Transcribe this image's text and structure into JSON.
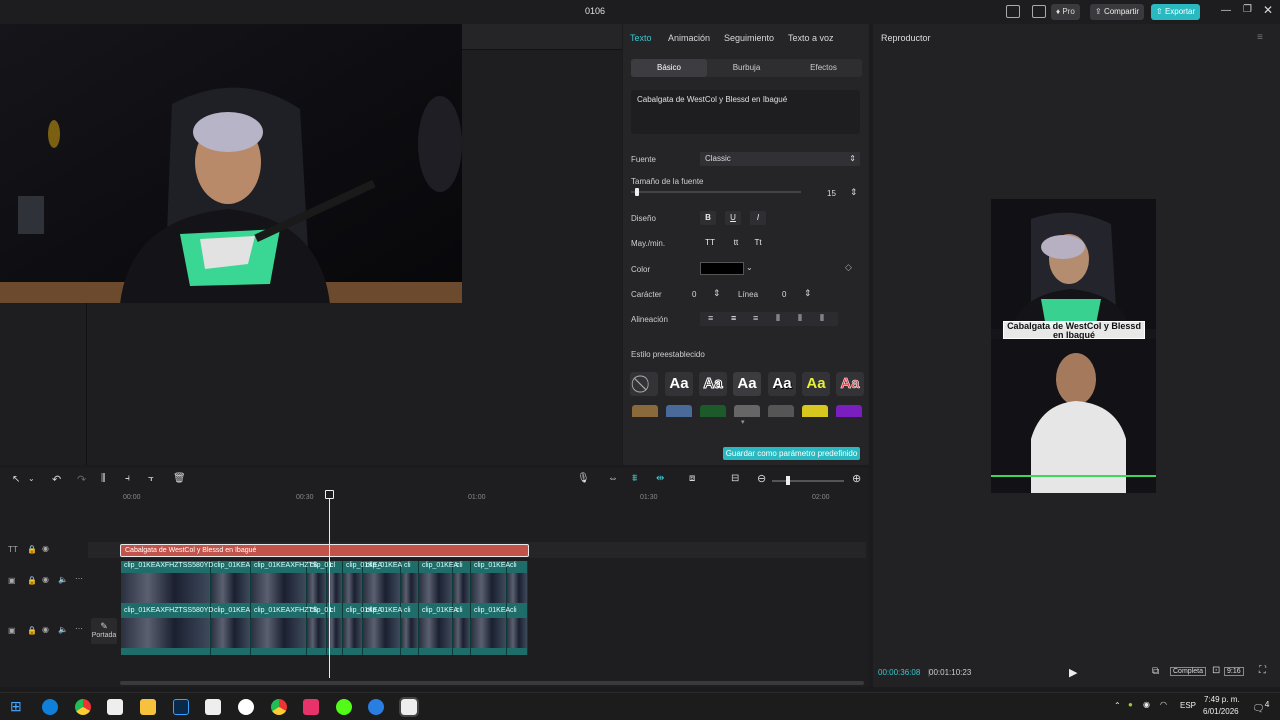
{
  "window": {
    "title": "0106",
    "pro_label": "Pro",
    "share_label": "Compartir",
    "export_label": "Exportar"
  },
  "properties": {
    "tabs": [
      "Texto",
      "Animación",
      "Seguimiento",
      "Texto a voz"
    ],
    "subtabs": [
      "Básico",
      "Burbuja",
      "Efectos"
    ],
    "text_value": "Cabalgata de WestCol y Blessd  en Ibagué",
    "font_label": "Fuente",
    "font_value": "Classic",
    "size_label": "Tamaño de la fuente",
    "size_value": "15",
    "design_label": "Diseño",
    "design_buttons": [
      "B",
      "U",
      "I"
    ],
    "case_label": "May./min.",
    "case_buttons": [
      "TT",
      "tt",
      "Tt"
    ],
    "color_label": "Color",
    "color_value": "#000000",
    "char_label": "Carácter",
    "char_value": "0",
    "line_label": "Línea",
    "line_value": "0",
    "align_label": "Alineación",
    "preset_label": "Estilo preestablecido",
    "preset_glyph": "Aa",
    "save_preset_label": "Guardar como parámetro predefinido"
  },
  "player": {
    "title": "Reproductor",
    "caption": "Cabalgata de WestCol y Blessd  en Ibagué",
    "current_time": "00:00:36:08",
    "total_time": "00:01:10:23",
    "full_label": "Completa",
    "ratio_label": "9:16"
  },
  "timeline": {
    "ruler": [
      "00:00",
      "00:30",
      "01:00",
      "01:30",
      "02:00"
    ],
    "text_clip": "Cabalgata de WestCol y Blessd  en Ibagué",
    "video_clips_top": [
      "clip_01KEAXFHZTSS580YD",
      "clip_01KEA",
      "clip_01KEAXFHZTS",
      "clip_01",
      "cl",
      "clip_01KEA",
      "clip_01KEA",
      "cli",
      "clip_01KEA",
      "cli",
      "clip_01KEA",
      "cli"
    ],
    "video_clips_bottom": [
      "clip_01KEAXFHZTSS580YD",
      "clip_01KEA",
      "clip_01KEAXFHZTS",
      "clip_01",
      "cl",
      "clip_01KEA",
      "clip_01KEA",
      "cli",
      "clip_01KEA",
      "cli",
      "clip_01KEA",
      "cli"
    ],
    "cover_label": "Portada"
  },
  "taskbar": {
    "lang": "ESP",
    "time": "7:49 p. m.",
    "date": "6/01/2026",
    "notif": "4"
  },
  "colors": {
    "accent": "#2bb9c1",
    "text_clip": "#c1534a",
    "video_clip": "#1e6d6a"
  }
}
